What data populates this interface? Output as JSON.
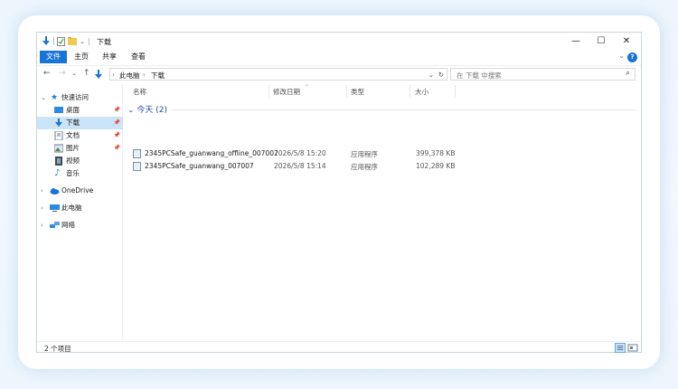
{
  "window": {
    "title": "下载",
    "quick_access_divider": "|"
  },
  "controls": {
    "minimize": "—",
    "maximize": "☐",
    "close": "✕"
  },
  "ribbon": {
    "tabs": [
      "文件",
      "主页",
      "共享",
      "查看"
    ],
    "collapse": "⌄",
    "help": "?"
  },
  "address": {
    "back": "←",
    "forward": "→",
    "recent": "⌄",
    "up": "↑",
    "crumbs": [
      "此电脑",
      "下载"
    ],
    "separator": "›",
    "dropdown": "⌄",
    "refresh": "↻"
  },
  "search": {
    "placeholder": "在 下载 中搜索",
    "icon": "⌕"
  },
  "nav": {
    "quick_access": "快速访问",
    "items": [
      {
        "label": "桌面",
        "pinned": true
      },
      {
        "label": "下载",
        "pinned": true,
        "selected": true
      },
      {
        "label": "文档",
        "pinned": true
      },
      {
        "label": "图片",
        "pinned": true
      },
      {
        "label": "视频",
        "pinned": false
      },
      {
        "label": "音乐",
        "pinned": false
      }
    ],
    "onedrive": "OneDrive",
    "this_pc": "此电脑",
    "network": "网络"
  },
  "columns": {
    "name": "名称",
    "date": "修改日期",
    "type": "类型",
    "size": "大小"
  },
  "group": {
    "label": "今天 (2)",
    "chevron": "⌄"
  },
  "files": [
    {
      "name": "2345PCSafe_guanwang_offline_007007",
      "date": "2026/5/8 15:20",
      "type": "应用程序",
      "size": "399,378 KB"
    },
    {
      "name": "2345PCSafe_guanwang_007007",
      "date": "2026/5/8 15:14",
      "type": "应用程序",
      "size": "102,289 KB"
    }
  ],
  "status": {
    "count": "2 个项目"
  },
  "colors": {
    "accent": "#1a74d8",
    "selected": "#cce4f7",
    "group": "#1f4e9e"
  }
}
